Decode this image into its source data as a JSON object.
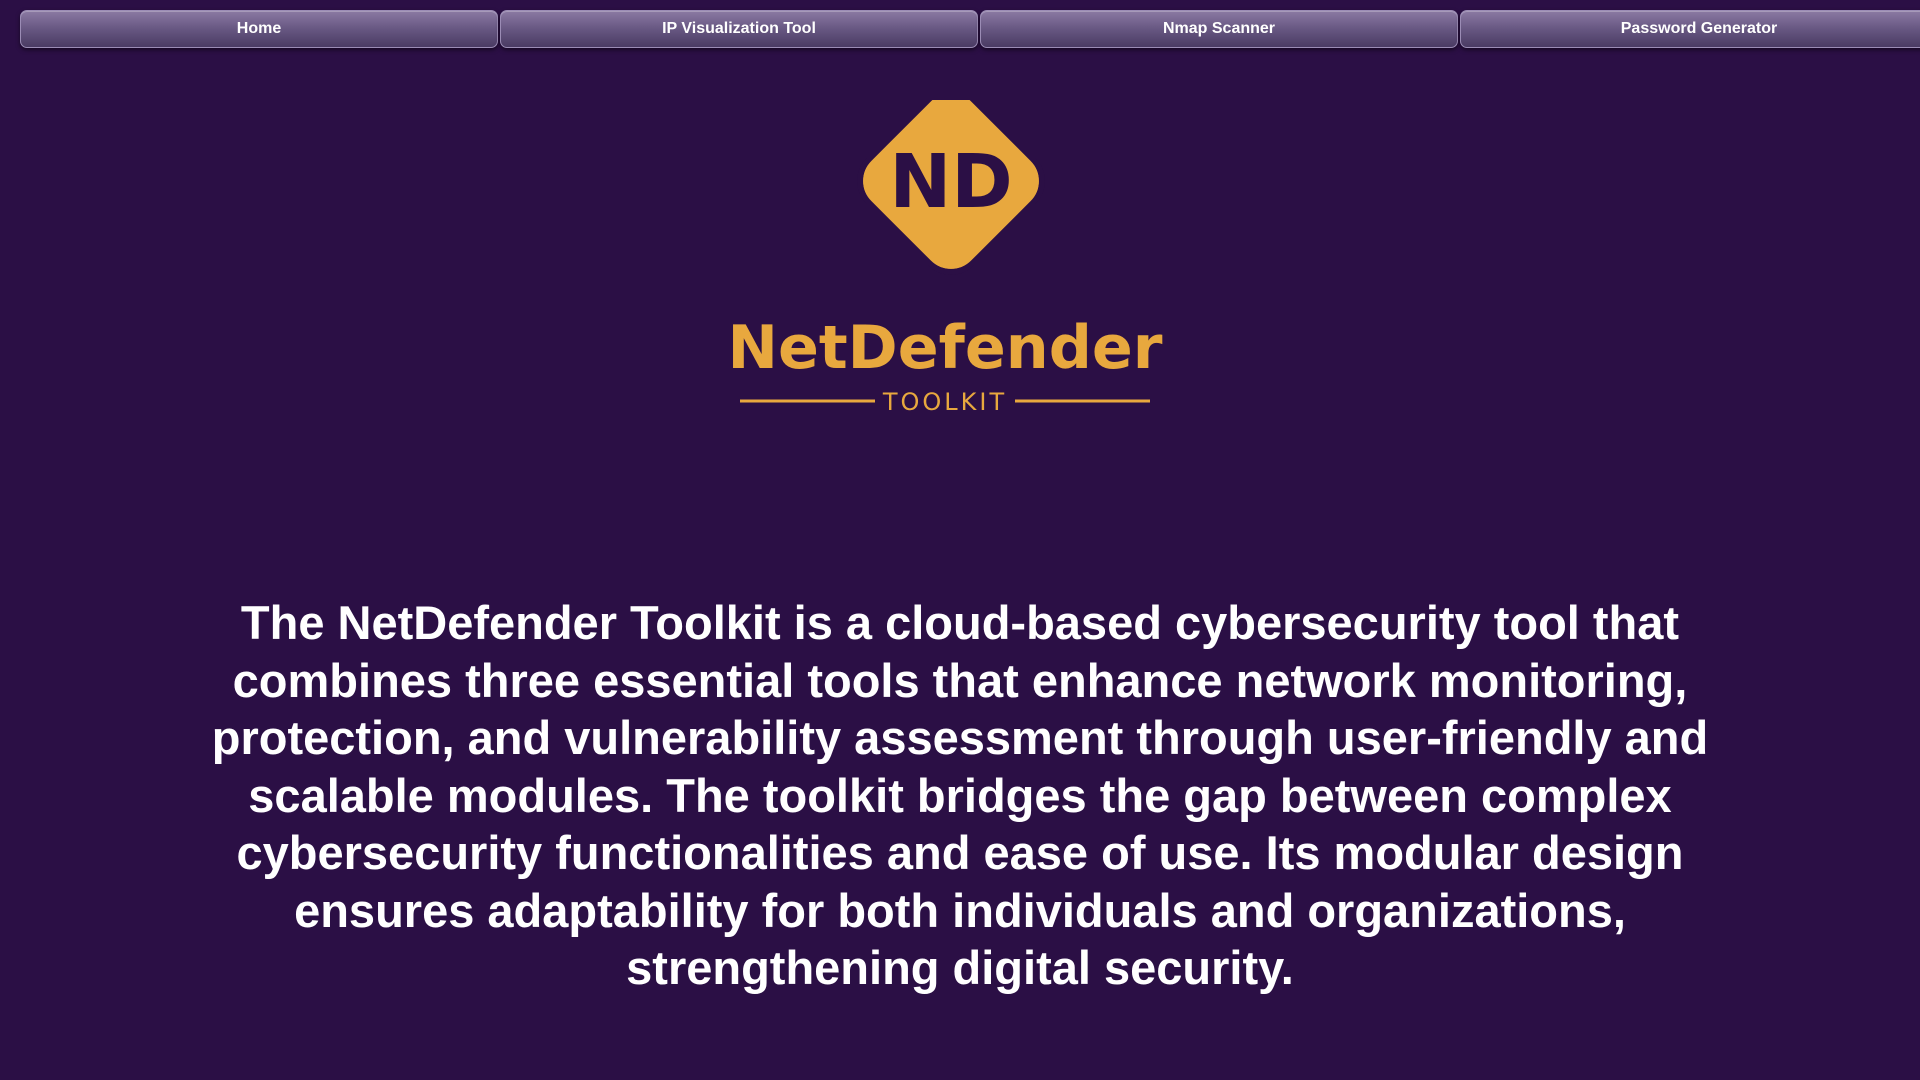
{
  "nav": {
    "items": [
      {
        "label": "Home"
      },
      {
        "label": "IP Visualization Tool"
      },
      {
        "label": "Nmap Scanner"
      },
      {
        "label": "Password Generator"
      }
    ]
  },
  "logo": {
    "monogram": "ND",
    "name": "NetDefender",
    "tagline": "TOOLKIT",
    "accent_color": "#e8a83e",
    "dark_color": "#2b0f45"
  },
  "main": {
    "description": "The NetDefender Toolkit is a cloud-based cybersecurity tool that combines three essential tools that enhance network monitoring, protection, and vulnerability assessment through user-friendly and scalable modules. The toolkit bridges the gap between complex cybersecurity functionalities and ease of use. Its modular design ensures adaptability for both individuals and organizations, strengthening digital security."
  }
}
